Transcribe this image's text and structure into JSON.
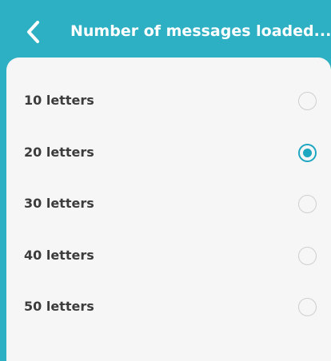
{
  "header": {
    "title": "Number of messages loaded...",
    "back_icon": "chevron-left-icon",
    "background_color": "#2eb0c4"
  },
  "options": [
    {
      "label": "10 letters",
      "selected": false
    },
    {
      "label": "20 letters",
      "selected": true
    },
    {
      "label": "30 letters",
      "selected": false
    },
    {
      "label": "40 letters",
      "selected": false
    },
    {
      "label": "50 letters",
      "selected": false
    }
  ],
  "colors": {
    "accent": "#1ea7c0",
    "panel_background": "#f6f6f6",
    "text": "#3c3c3c"
  }
}
